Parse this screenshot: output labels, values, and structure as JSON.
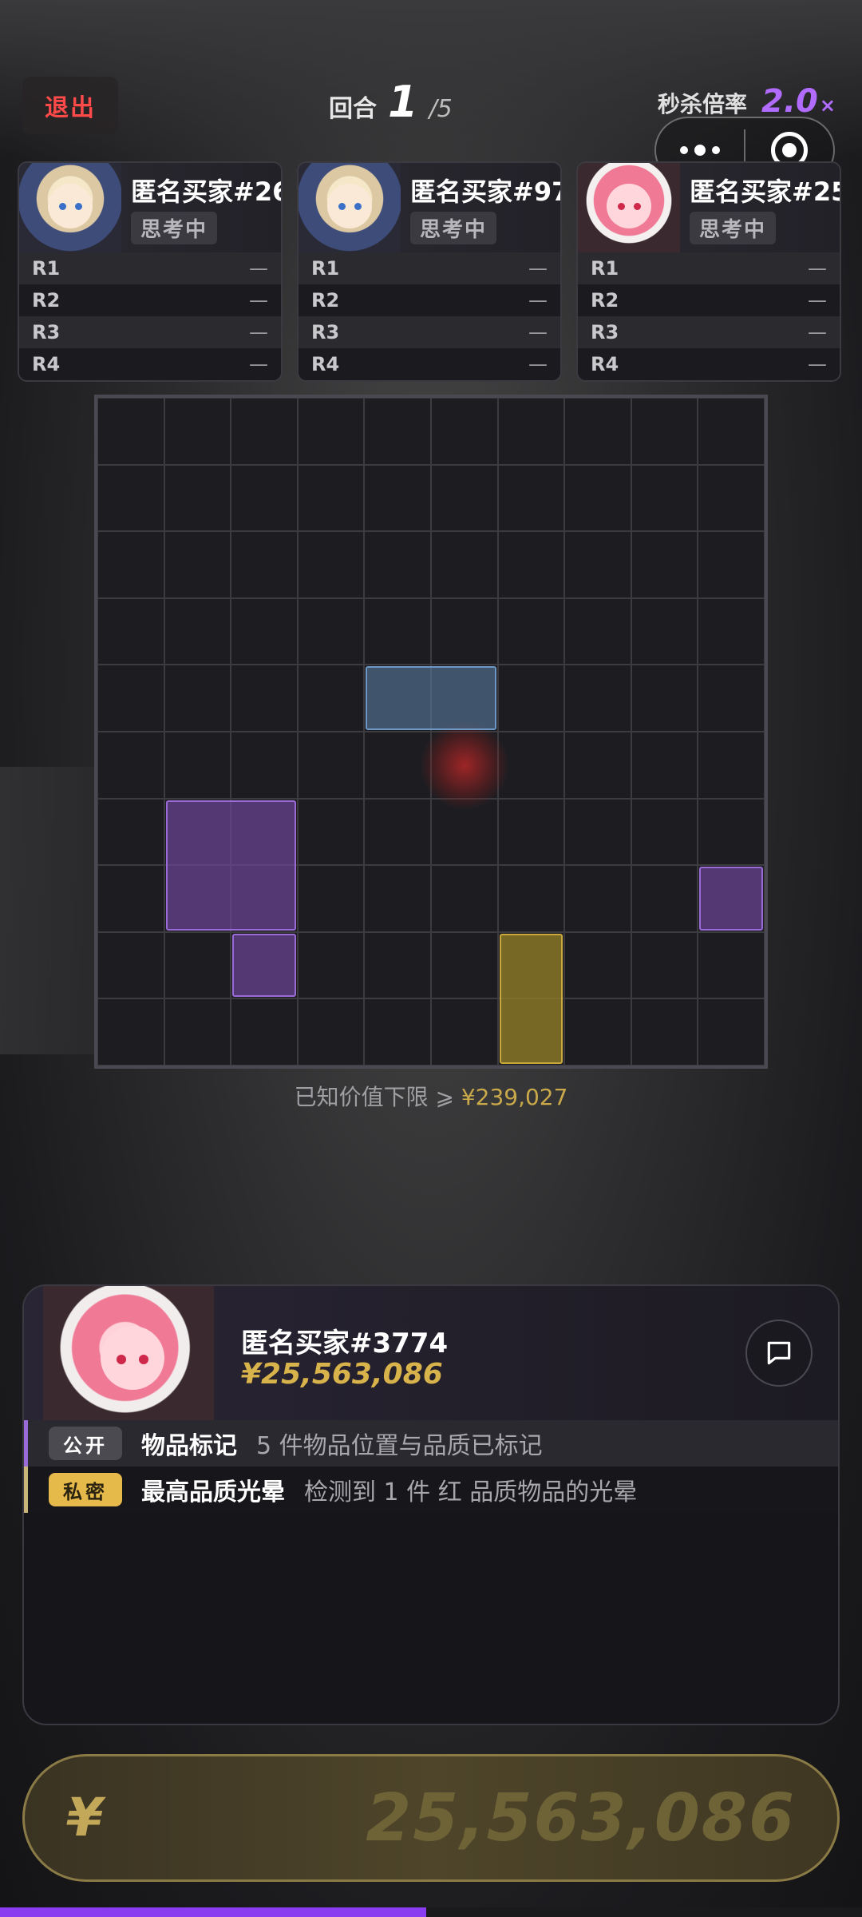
{
  "header": {
    "exit_label": "退出",
    "round_label": "回合",
    "round_current": "1",
    "round_total": "/5",
    "multiplier_label": "秒杀倍率",
    "multiplier_value": "2.0",
    "multiplier_suffix": "×"
  },
  "capsule": {
    "more_icon": "more-dots-icon",
    "close_icon": "target-close-icon"
  },
  "players": [
    {
      "name": "匿名买家#26",
      "status": "思考中",
      "avatar": "blonde",
      "rounds": [
        {
          "label": "R1",
          "value": "—"
        },
        {
          "label": "R2",
          "value": "—"
        },
        {
          "label": "R3",
          "value": "—"
        },
        {
          "label": "R4",
          "value": "—"
        }
      ]
    },
    {
      "name": "匿名买家#97",
      "status": "思考中",
      "avatar": "blonde",
      "rounds": [
        {
          "label": "R1",
          "value": "—"
        },
        {
          "label": "R2",
          "value": "—"
        },
        {
          "label": "R3",
          "value": "—"
        },
        {
          "label": "R4",
          "value": "—"
        }
      ]
    },
    {
      "name": "匿名买家#25",
      "status": "思考中",
      "avatar": "pink",
      "rounds": [
        {
          "label": "R1",
          "value": "—"
        },
        {
          "label": "R2",
          "value": "—"
        },
        {
          "label": "R3",
          "value": "—"
        },
        {
          "label": "R4",
          "value": "—"
        }
      ]
    }
  ],
  "board": {
    "cols": 10,
    "rows": 10,
    "items": [
      {
        "quality": "blue",
        "col": 4,
        "row": 4,
        "w": 2,
        "h": 1
      },
      {
        "quality": "purple",
        "col": 1,
        "row": 6,
        "w": 2,
        "h": 2
      },
      {
        "quality": "purple",
        "col": 2,
        "row": 8,
        "w": 1,
        "h": 1
      },
      {
        "quality": "purple",
        "col": 9,
        "row": 7,
        "w": 1,
        "h": 1
      },
      {
        "quality": "gold",
        "col": 6,
        "row": 8,
        "w": 1,
        "h": 2
      }
    ],
    "red_glow": {
      "col": 5,
      "row": 5
    }
  },
  "known_value": {
    "label": "已知价值下限 ⩾ ",
    "amount": "¥239,027"
  },
  "me": {
    "name": "匿名买家#3774",
    "money": "¥25,563,086",
    "chat_icon": "chat-bubble-icon"
  },
  "log": [
    {
      "tag": "公开",
      "kind": "pub",
      "title": "物品标记",
      "desc": "5 件物品位置与品质已标记"
    },
    {
      "tag": "私密",
      "kind": "pri",
      "title": "最高品质光晕",
      "desc": "检测到 1 件 红 品质物品的光晕"
    }
  ],
  "bid": {
    "currency": "¥",
    "value": "25,563,086"
  },
  "progress": 0.494,
  "colors": {
    "accent": "#8a3cf0",
    "gold": "#d8b24a",
    "danger": "#ff4a4a"
  }
}
